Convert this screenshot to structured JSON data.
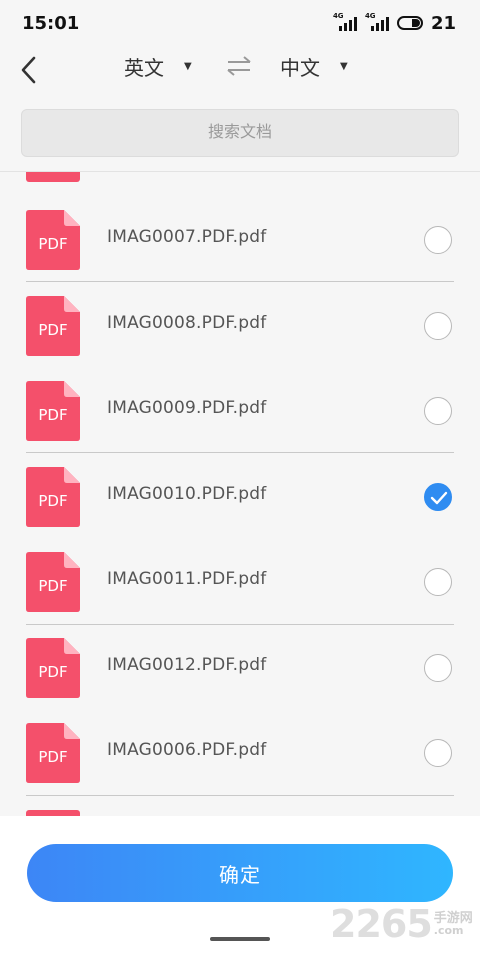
{
  "status_bar": {
    "time": "15:01",
    "network_1": "4G",
    "network_2": "4G",
    "battery": "21"
  },
  "lang_bar": {
    "source_lang": "英文",
    "target_lang": "中文",
    "caret": "▼"
  },
  "search": {
    "placeholder": "搜索文档"
  },
  "files": [
    {
      "name": "IMAG0007.PDF.pdf",
      "icon_label": "PDF",
      "selected": false
    },
    {
      "name": "IMAG0008.PDF.pdf",
      "icon_label": "PDF",
      "selected": false
    },
    {
      "name": "IMAG0009.PDF.pdf",
      "icon_label": "PDF",
      "selected": false
    },
    {
      "name": "IMAG0010.PDF.pdf",
      "icon_label": "PDF",
      "selected": true
    },
    {
      "name": "IMAG0011.PDF.pdf",
      "icon_label": "PDF",
      "selected": false
    },
    {
      "name": "IMAG0012.PDF.pdf",
      "icon_label": "PDF",
      "selected": false
    },
    {
      "name": "IMAG0006.PDF.pdf",
      "icon_label": "PDF",
      "selected": false
    }
  ],
  "footer": {
    "confirm_label": "确定"
  },
  "watermark": {
    "number": "2265",
    "cn": "手游网",
    "domain": ".com"
  },
  "colors": {
    "pdf_red": "#f4506b",
    "accent_blue": "#2f8cf1",
    "button_start": "#3d86f6",
    "button_end": "#2fb6ff"
  }
}
